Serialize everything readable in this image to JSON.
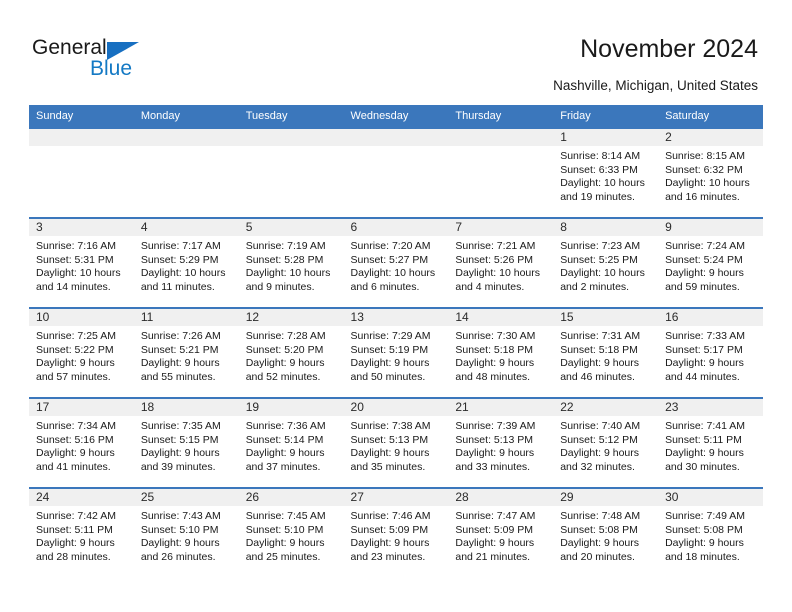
{
  "brand": {
    "name_part1": "General",
    "name_part2": "Blue",
    "triangle_color": "#176fc1",
    "blue_color": "#1479c4"
  },
  "header": {
    "title": "November 2024",
    "subtitle": "Nashville, Michigan, United States"
  },
  "theme": {
    "header_bg": "#3b77bc",
    "daynum_bg": "#f0f0f0",
    "row_border": "#3b77bc",
    "text": "#1a1a1a"
  },
  "weekdays": [
    "Sunday",
    "Monday",
    "Tuesday",
    "Wednesday",
    "Thursday",
    "Friday",
    "Saturday"
  ],
  "labels": {
    "sunrise_prefix": "Sunrise: ",
    "sunset_prefix": "Sunset: ",
    "daylight_prefix": "Daylight: "
  },
  "weeks": [
    [
      {
        "day": "",
        "blank": true,
        "line1": "",
        "line2": "",
        "line3": "",
        "line4": ""
      },
      {
        "day": "",
        "blank": true,
        "line1": "",
        "line2": "",
        "line3": "",
        "line4": ""
      },
      {
        "day": "",
        "blank": true,
        "line1": "",
        "line2": "",
        "line3": "",
        "line4": ""
      },
      {
        "day": "",
        "blank": true,
        "line1": "",
        "line2": "",
        "line3": "",
        "line4": ""
      },
      {
        "day": "",
        "blank": true,
        "line1": "",
        "line2": "",
        "line3": "",
        "line4": ""
      },
      {
        "day": "1",
        "blank": false,
        "line1": "Sunrise: 8:14 AM",
        "line2": "Sunset: 6:33 PM",
        "line3": "Daylight: 10 hours",
        "line4": "and 19 minutes."
      },
      {
        "day": "2",
        "blank": false,
        "line1": "Sunrise: 8:15 AM",
        "line2": "Sunset: 6:32 PM",
        "line3": "Daylight: 10 hours",
        "line4": "and 16 minutes."
      }
    ],
    [
      {
        "day": "3",
        "blank": false,
        "line1": "Sunrise: 7:16 AM",
        "line2": "Sunset: 5:31 PM",
        "line3": "Daylight: 10 hours",
        "line4": "and 14 minutes."
      },
      {
        "day": "4",
        "blank": false,
        "line1": "Sunrise: 7:17 AM",
        "line2": "Sunset: 5:29 PM",
        "line3": "Daylight: 10 hours",
        "line4": "and 11 minutes."
      },
      {
        "day": "5",
        "blank": false,
        "line1": "Sunrise: 7:19 AM",
        "line2": "Sunset: 5:28 PM",
        "line3": "Daylight: 10 hours",
        "line4": "and 9 minutes."
      },
      {
        "day": "6",
        "blank": false,
        "line1": "Sunrise: 7:20 AM",
        "line2": "Sunset: 5:27 PM",
        "line3": "Daylight: 10 hours",
        "line4": "and 6 minutes."
      },
      {
        "day": "7",
        "blank": false,
        "line1": "Sunrise: 7:21 AM",
        "line2": "Sunset: 5:26 PM",
        "line3": "Daylight: 10 hours",
        "line4": "and 4 minutes."
      },
      {
        "day": "8",
        "blank": false,
        "line1": "Sunrise: 7:23 AM",
        "line2": "Sunset: 5:25 PM",
        "line3": "Daylight: 10 hours",
        "line4": "and 2 minutes."
      },
      {
        "day": "9",
        "blank": false,
        "line1": "Sunrise: 7:24 AM",
        "line2": "Sunset: 5:24 PM",
        "line3": "Daylight: 9 hours",
        "line4": "and 59 minutes."
      }
    ],
    [
      {
        "day": "10",
        "blank": false,
        "line1": "Sunrise: 7:25 AM",
        "line2": "Sunset: 5:22 PM",
        "line3": "Daylight: 9 hours",
        "line4": "and 57 minutes."
      },
      {
        "day": "11",
        "blank": false,
        "line1": "Sunrise: 7:26 AM",
        "line2": "Sunset: 5:21 PM",
        "line3": "Daylight: 9 hours",
        "line4": "and 55 minutes."
      },
      {
        "day": "12",
        "blank": false,
        "line1": "Sunrise: 7:28 AM",
        "line2": "Sunset: 5:20 PM",
        "line3": "Daylight: 9 hours",
        "line4": "and 52 minutes."
      },
      {
        "day": "13",
        "blank": false,
        "line1": "Sunrise: 7:29 AM",
        "line2": "Sunset: 5:19 PM",
        "line3": "Daylight: 9 hours",
        "line4": "and 50 minutes."
      },
      {
        "day": "14",
        "blank": false,
        "line1": "Sunrise: 7:30 AM",
        "line2": "Sunset: 5:18 PM",
        "line3": "Daylight: 9 hours",
        "line4": "and 48 minutes."
      },
      {
        "day": "15",
        "blank": false,
        "line1": "Sunrise: 7:31 AM",
        "line2": "Sunset: 5:18 PM",
        "line3": "Daylight: 9 hours",
        "line4": "and 46 minutes."
      },
      {
        "day": "16",
        "blank": false,
        "line1": "Sunrise: 7:33 AM",
        "line2": "Sunset: 5:17 PM",
        "line3": "Daylight: 9 hours",
        "line4": "and 44 minutes."
      }
    ],
    [
      {
        "day": "17",
        "blank": false,
        "line1": "Sunrise: 7:34 AM",
        "line2": "Sunset: 5:16 PM",
        "line3": "Daylight: 9 hours",
        "line4": "and 41 minutes."
      },
      {
        "day": "18",
        "blank": false,
        "line1": "Sunrise: 7:35 AM",
        "line2": "Sunset: 5:15 PM",
        "line3": "Daylight: 9 hours",
        "line4": "and 39 minutes."
      },
      {
        "day": "19",
        "blank": false,
        "line1": "Sunrise: 7:36 AM",
        "line2": "Sunset: 5:14 PM",
        "line3": "Daylight: 9 hours",
        "line4": "and 37 minutes."
      },
      {
        "day": "20",
        "blank": false,
        "line1": "Sunrise: 7:38 AM",
        "line2": "Sunset: 5:13 PM",
        "line3": "Daylight: 9 hours",
        "line4": "and 35 minutes."
      },
      {
        "day": "21",
        "blank": false,
        "line1": "Sunrise: 7:39 AM",
        "line2": "Sunset: 5:13 PM",
        "line3": "Daylight: 9 hours",
        "line4": "and 33 minutes."
      },
      {
        "day": "22",
        "blank": false,
        "line1": "Sunrise: 7:40 AM",
        "line2": "Sunset: 5:12 PM",
        "line3": "Daylight: 9 hours",
        "line4": "and 32 minutes."
      },
      {
        "day": "23",
        "blank": false,
        "line1": "Sunrise: 7:41 AM",
        "line2": "Sunset: 5:11 PM",
        "line3": "Daylight: 9 hours",
        "line4": "and 30 minutes."
      }
    ],
    [
      {
        "day": "24",
        "blank": false,
        "line1": "Sunrise: 7:42 AM",
        "line2": "Sunset: 5:11 PM",
        "line3": "Daylight: 9 hours",
        "line4": "and 28 minutes."
      },
      {
        "day": "25",
        "blank": false,
        "line1": "Sunrise: 7:43 AM",
        "line2": "Sunset: 5:10 PM",
        "line3": "Daylight: 9 hours",
        "line4": "and 26 minutes."
      },
      {
        "day": "26",
        "blank": false,
        "line1": "Sunrise: 7:45 AM",
        "line2": "Sunset: 5:10 PM",
        "line3": "Daylight: 9 hours",
        "line4": "and 25 minutes."
      },
      {
        "day": "27",
        "blank": false,
        "line1": "Sunrise: 7:46 AM",
        "line2": "Sunset: 5:09 PM",
        "line3": "Daylight: 9 hours",
        "line4": "and 23 minutes."
      },
      {
        "day": "28",
        "blank": false,
        "line1": "Sunrise: 7:47 AM",
        "line2": "Sunset: 5:09 PM",
        "line3": "Daylight: 9 hours",
        "line4": "and 21 minutes."
      },
      {
        "day": "29",
        "blank": false,
        "line1": "Sunrise: 7:48 AM",
        "line2": "Sunset: 5:08 PM",
        "line3": "Daylight: 9 hours",
        "line4": "and 20 minutes."
      },
      {
        "day": "30",
        "blank": false,
        "line1": "Sunrise: 7:49 AM",
        "line2": "Sunset: 5:08 PM",
        "line3": "Daylight: 9 hours",
        "line4": "and 18 minutes."
      }
    ]
  ]
}
